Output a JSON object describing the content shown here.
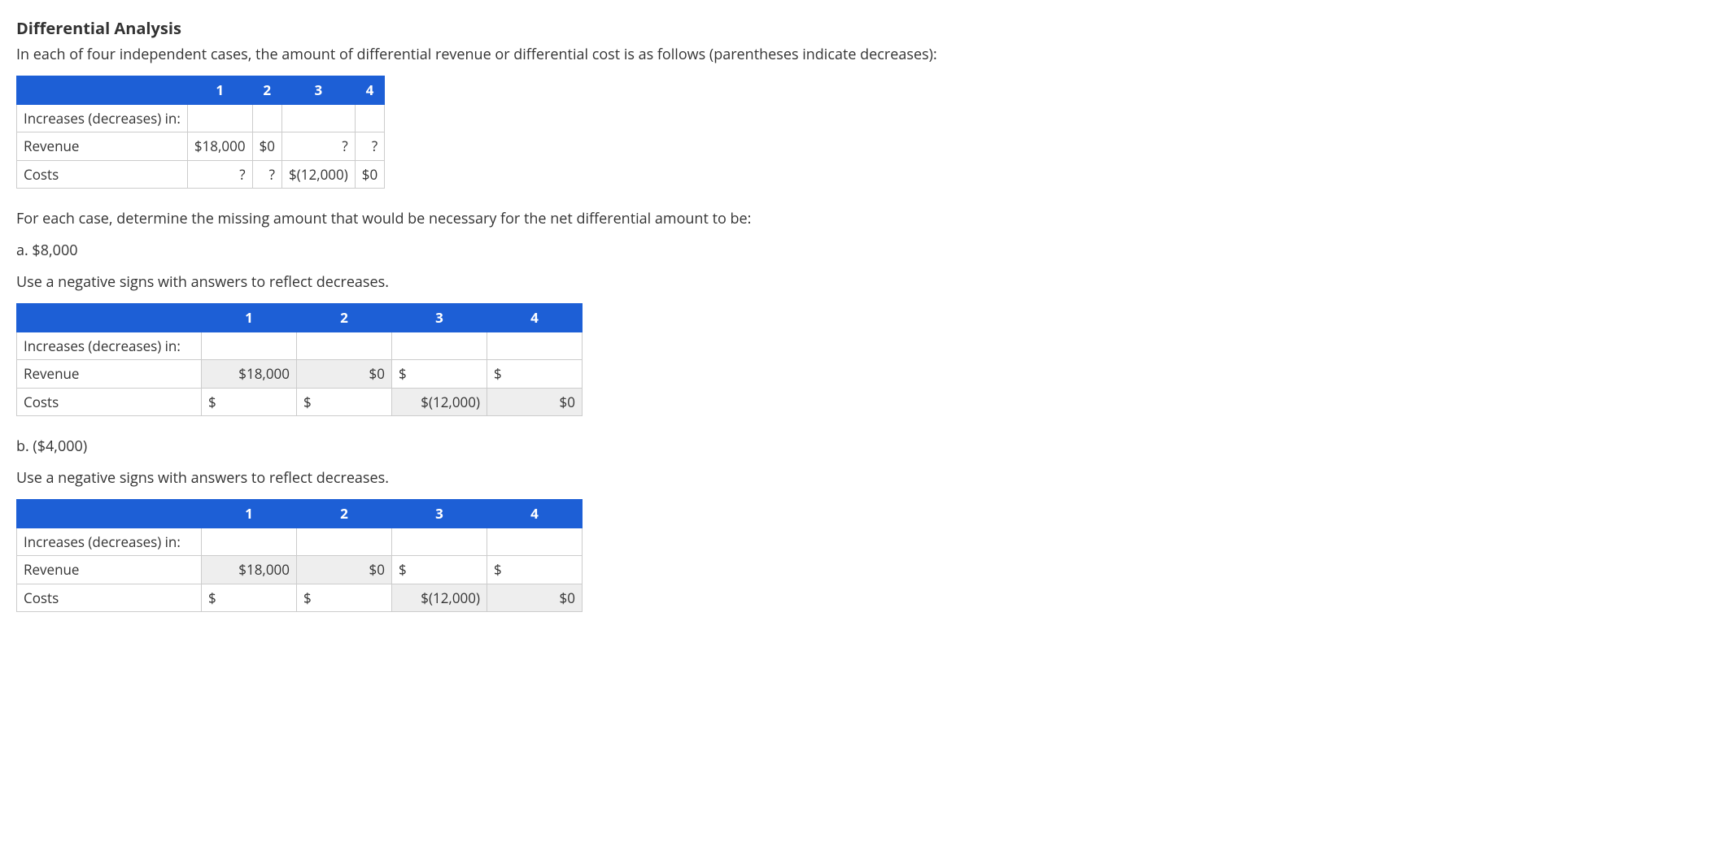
{
  "title": "Differential Analysis",
  "intro": "In each of four independent cases, the amount of differential revenue or differential cost is as follows (parentheses indicate decreases):",
  "given_table": {
    "col_headers": [
      "1",
      "2",
      "3",
      "4"
    ],
    "row_labels": [
      "Increases (decreases) in:",
      "Revenue",
      "Costs"
    ],
    "revenue": [
      "$18,000",
      "$0",
      "?",
      "?"
    ],
    "costs": [
      "?",
      "?",
      "$(12,000)",
      "$0"
    ]
  },
  "prompt": "For each case, determine the missing amount that would be necessary for the net differential amount to be:",
  "part_a": {
    "label": "a. $8,000",
    "note": "Use a negative signs with answers to reflect decreases."
  },
  "part_b": {
    "label": "b. ($4,000)",
    "note": "Use a negative signs with answers to reflect decreases."
  },
  "answer_table": {
    "col_headers": [
      "1",
      "2",
      "3",
      "4"
    ],
    "row_labels": [
      "Increases (decreases) in:",
      "Revenue",
      "Costs"
    ],
    "revenue_fixed": {
      "c1": "$18,000",
      "c2": "$0"
    },
    "costs_fixed": {
      "c3": "$(12,000)",
      "c4": "$0"
    },
    "currency": "$"
  }
}
